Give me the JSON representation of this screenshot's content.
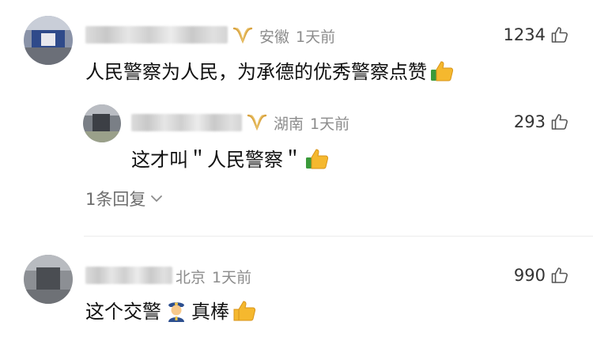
{
  "comments": [
    {
      "location": "安徽",
      "time": "1天前",
      "likes": "1234",
      "text": "人民警察为人民，为承德的优秀警察点赞"
    },
    {
      "location": "湖南",
      "time": "1天前",
      "likes": "293",
      "text": "这才叫＂人民警察＂"
    },
    {
      "location": "北京",
      "time": "1天前",
      "likes": "990",
      "text_before": "这个交警",
      "text_after": "真棒"
    }
  ],
  "replies": {
    "expand_label": "1条回复"
  },
  "icons": {
    "like": "thumb-up-outline-icon",
    "vip": "gold-vip-badge-icon",
    "emoji_thumb": "thumbs-up-emoji",
    "emoji_police": "police-officer-emoji"
  },
  "colors": {
    "meta": "#8c8c8c",
    "vip_gold": "#d9a441",
    "divider": "#ececec"
  }
}
